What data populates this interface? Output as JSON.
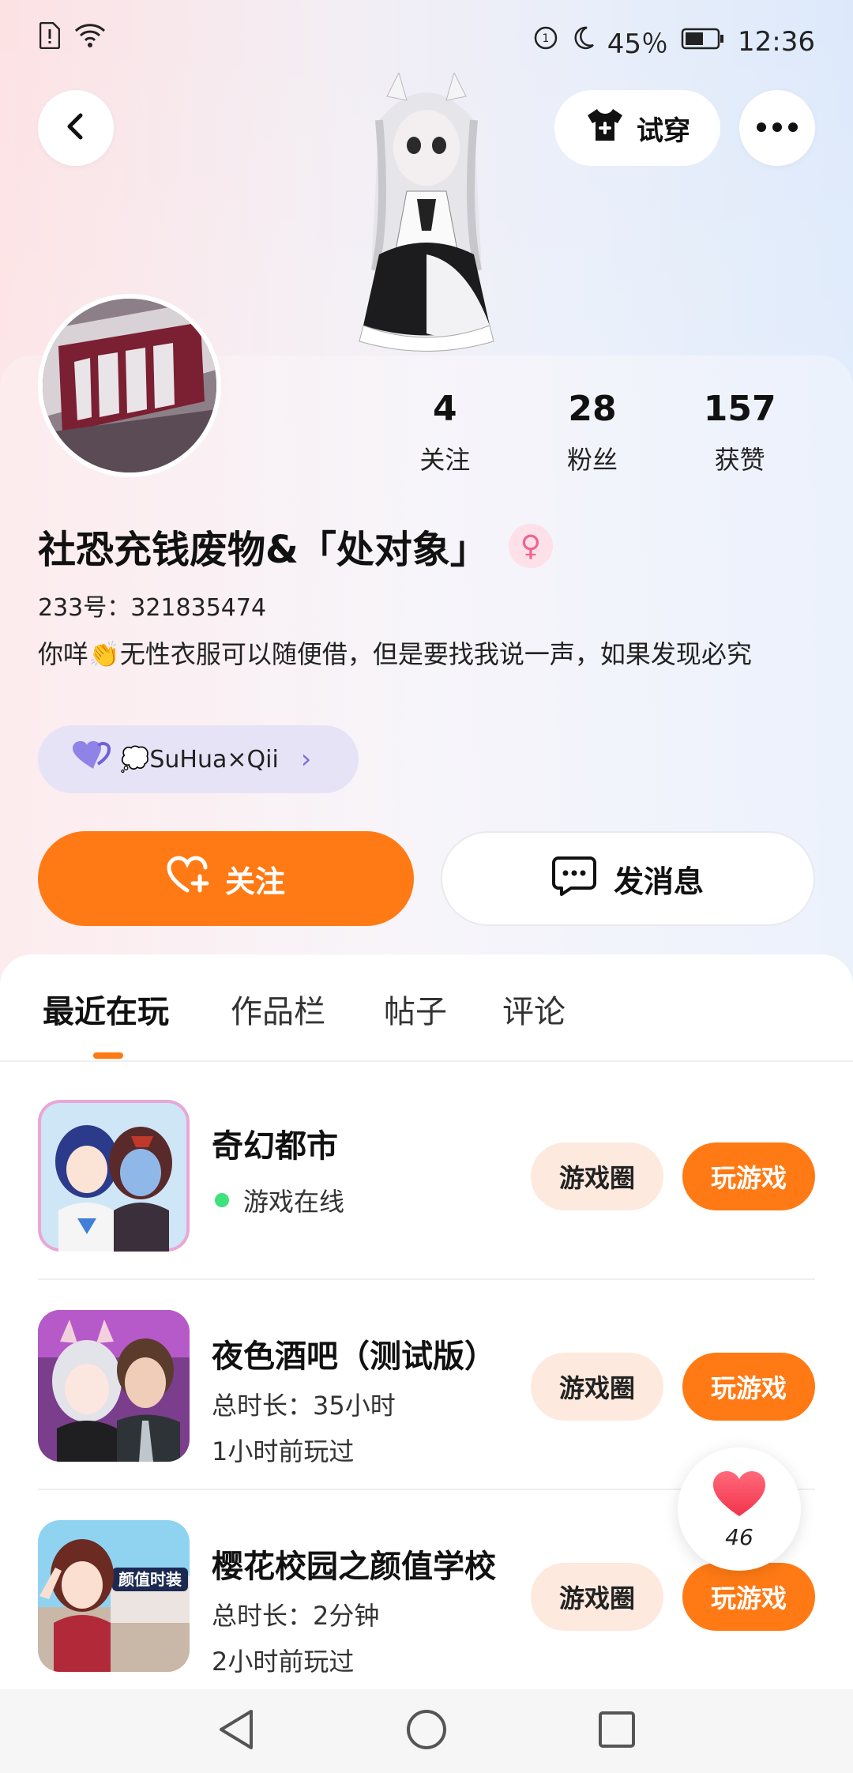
{
  "status_bar": {
    "battery_percent": "45％",
    "time": "12:36"
  },
  "header": {
    "try_on_label": "试穿"
  },
  "profile": {
    "stats": [
      {
        "value": "4",
        "label": "关注"
      },
      {
        "value": "28",
        "label": "粉丝"
      },
      {
        "value": "157",
        "label": "获赞"
      }
    ],
    "nickname": "社恐充钱废物&「处对象」",
    "gender_symbol": "♀",
    "uid": "233号：321835474",
    "bio": "你咩👏无性衣服可以随便借，但是要找我说一声，如果发现必究",
    "couple_chip": {
      "label": "💭SuHua×Qii",
      "chevron": "›"
    },
    "follow_label": "关注",
    "message_label": "发消息"
  },
  "tabs": [
    {
      "label": "最近在玩"
    },
    {
      "label": "作品栏"
    },
    {
      "label": "帖子"
    },
    {
      "label": "评论"
    }
  ],
  "games": [
    {
      "title": "奇幻都市",
      "status": "游戏在线",
      "circle_label": "游戏圈",
      "play_label": "玩游戏"
    },
    {
      "title": "夜色酒吧（测试版）",
      "total_time": "总时长：35小时",
      "last_played": "1小时前玩过",
      "circle_label": "游戏圈",
      "play_label": "玩游戏"
    },
    {
      "title": "樱花校园之颜值学校",
      "total_time": "总时长：2分钟",
      "last_played": "2小时前玩过",
      "circle_label": "游戏圈",
      "play_label": "玩游戏",
      "thumb_text": "颜值时装"
    }
  ],
  "like_float": {
    "count": "46"
  },
  "colors": {
    "accent": "#ff7a14",
    "chip_bg": "#e7e3f7",
    "online": "#3ee27a"
  }
}
